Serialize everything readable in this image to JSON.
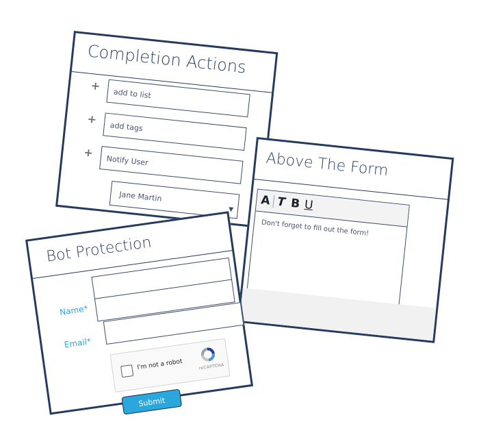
{
  "completion": {
    "title": "Completion Actions",
    "list_placeholder": "add to list",
    "tags_placeholder": "add tags",
    "notify_placeholder": "Notify User",
    "user_value": "Jane Martin"
  },
  "above": {
    "title": "Above The Form",
    "toolbar": {
      "font": "A",
      "italic": "T",
      "bold": "B",
      "underline": "U"
    },
    "editor_text": "Don't forget to fill out the form!"
  },
  "bot": {
    "title": "Bot Protection",
    "name_label": "Name*",
    "email_label": "Email*",
    "recaptcha_label": "I'm not a robot",
    "recaptcha_brand": "reCAPTCHA",
    "submit_label": "Submit"
  },
  "colors": {
    "border": "#243a5e",
    "accent": "#2aa7dd"
  }
}
